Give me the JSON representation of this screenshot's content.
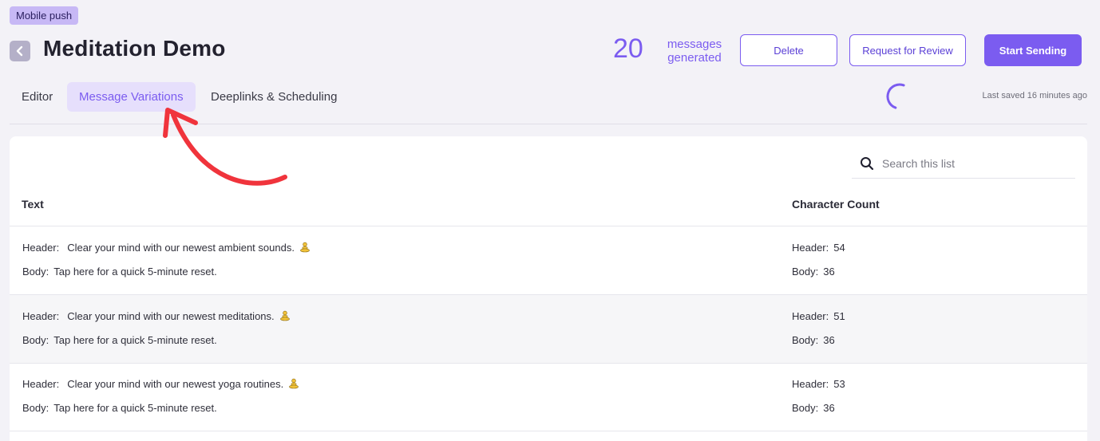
{
  "badge": "Mobile push",
  "title": "Meditation Demo",
  "stats": {
    "count": "20",
    "label_line1": "messages",
    "label_line2": "generated"
  },
  "actions": {
    "delete": "Delete",
    "review": "Request for Review",
    "send": "Start Sending"
  },
  "tabs": [
    {
      "label": "Editor",
      "active": false
    },
    {
      "label": "Message Variations",
      "active": true
    },
    {
      "label": "Deeplinks & Scheduling",
      "active": false
    }
  ],
  "last_saved": "Last saved 16 minutes ago",
  "search": {
    "placeholder": "Search this list",
    "icon": "search-icon"
  },
  "table": {
    "columns": [
      "Text",
      "Character Count"
    ],
    "header_label": "Header:",
    "body_label": "Body:",
    "rows": [
      {
        "header": "Clear your mind with our newest ambient sounds.",
        "body": "Tap here for a quick 5-minute reset.",
        "header_count": "54",
        "body_count": "36",
        "emoji": "meditation-emoji-icon"
      },
      {
        "header": "Clear your mind with our newest meditations.",
        "body": "Tap here for a quick 5-minute reset.",
        "header_count": "51",
        "body_count": "36",
        "emoji": "meditation-emoji-icon"
      },
      {
        "header": "Clear your mind with our newest yoga routines.",
        "body": "Tap here for a quick 5-minute reset.",
        "header_count": "53",
        "body_count": "36",
        "emoji": "meditation-emoji-icon"
      }
    ]
  },
  "colors": {
    "accent": "#7b5cf0",
    "annotation": "#f0343c",
    "badge_bg": "#c7b8f5",
    "tab_active_bg": "#e6dffc"
  }
}
